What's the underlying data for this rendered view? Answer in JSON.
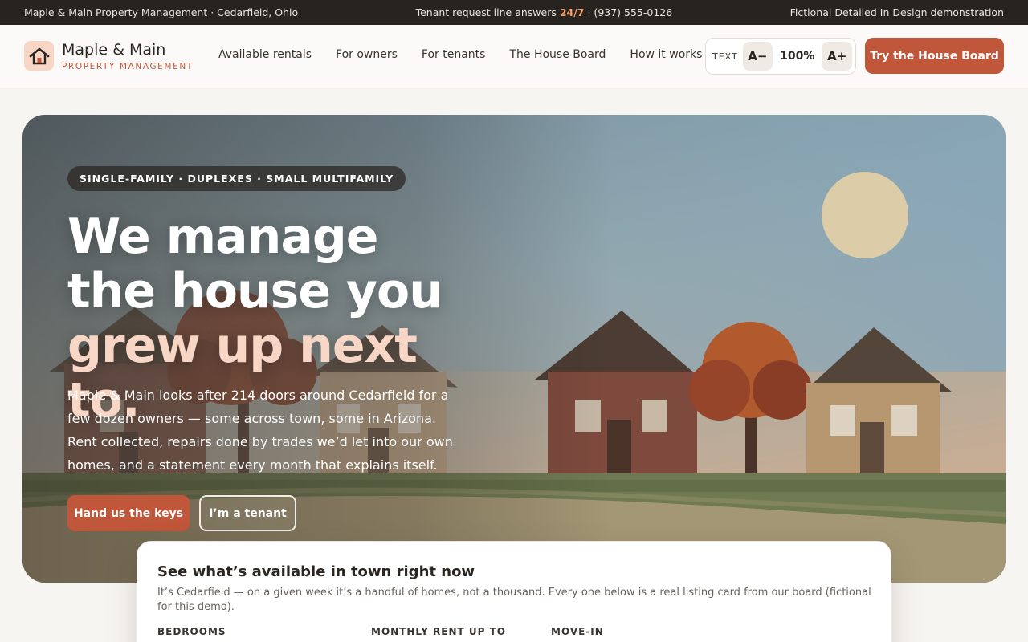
{
  "topbar": {
    "left": "Maple & Main Property Management · Cedarfield, Ohio",
    "mid_prefix": "Tenant request line answers ",
    "mid_highlight": "24/7",
    "mid_suffix": " · (937) 555-0126",
    "right": "Fictional Detailed In Design demonstration"
  },
  "brand": {
    "name": "Maple & Main",
    "tagline": "PROPERTY MANAGEMENT",
    "icon": "house-icon"
  },
  "nav": {
    "items": [
      "Available rentals",
      "For owners",
      "For tenants",
      "The House Board",
      "How it works"
    ]
  },
  "text_size": {
    "label": "TEXT",
    "decrease": "A−",
    "value": "100%",
    "increase": "A+"
  },
  "header_cta": "Try the House Board",
  "hero": {
    "pill": "SINGLE-FAMILY · DUPLEXES · SMALL MULTIFAMILY",
    "headline_plain": "We manage the house you ",
    "headline_accent": "grew up next to.",
    "lede": "Maple & Main looks after 214 doors around Cedarfield for a few dozen owners — some across town, some in Arizona. Rent collected, repairs done by trades we’d let into our own homes, and a statement every month that explains itself.",
    "primary_button": "Hand us the keys",
    "secondary_button": "I’m a tenant"
  },
  "search_card": {
    "title": "See what’s available in town right now",
    "description": "It’s Cedarfield — on a given week it’s a handful of homes, not a thousand. Every one below is a real listing card from our board (fictional for this demo).",
    "fields": [
      "BEDROOMS",
      "MONTHLY RENT UP TO",
      "MOVE-IN"
    ]
  },
  "colors": {
    "accent": "#c0563a",
    "accent_soft": "#f7d6c6",
    "dark": "#27231f"
  }
}
